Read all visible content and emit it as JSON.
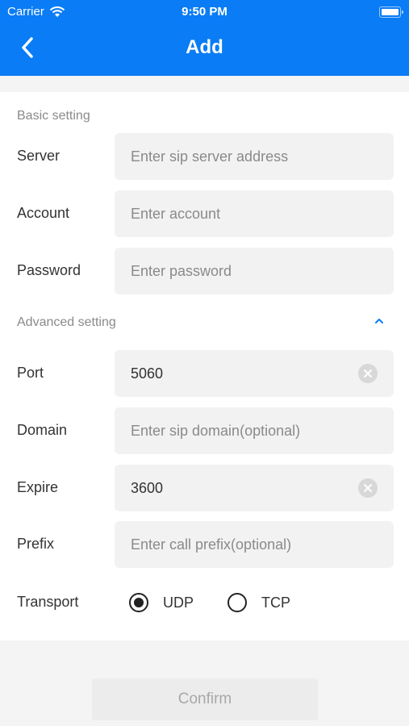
{
  "status_bar": {
    "carrier": "Carrier",
    "time": "9:50 PM",
    "wifi_icon": "wifi-icon",
    "battery_icon": "battery-icon"
  },
  "nav": {
    "title": "Add",
    "back_icon": "chevron-left-icon"
  },
  "basic_section": {
    "label": "Basic setting",
    "fields": [
      {
        "label": "Server",
        "placeholder": "Enter sip server address",
        "value": ""
      },
      {
        "label": "Account",
        "placeholder": "Enter account",
        "value": ""
      },
      {
        "label": "Password",
        "placeholder": "Enter password",
        "value": ""
      }
    ]
  },
  "advanced_section": {
    "label": "Advanced setting",
    "toggle_icon": "chevron-up-icon",
    "fields": [
      {
        "label": "Port",
        "placeholder": "",
        "value": "5060",
        "clearable": true
      },
      {
        "label": "Domain",
        "placeholder": "Enter sip domain(optional)",
        "value": ""
      },
      {
        "label": "Expire",
        "placeholder": "",
        "value": "3600",
        "clearable": true
      },
      {
        "label": "Prefix",
        "placeholder": "Enter call prefix(optional)",
        "value": ""
      }
    ],
    "transport": {
      "label": "Transport",
      "options": [
        "UDP",
        "TCP"
      ],
      "selected": "UDP"
    }
  },
  "confirm_label": "Confirm",
  "colors": {
    "accent": "#0a7cf5",
    "toggle": "#0a7cf5"
  }
}
